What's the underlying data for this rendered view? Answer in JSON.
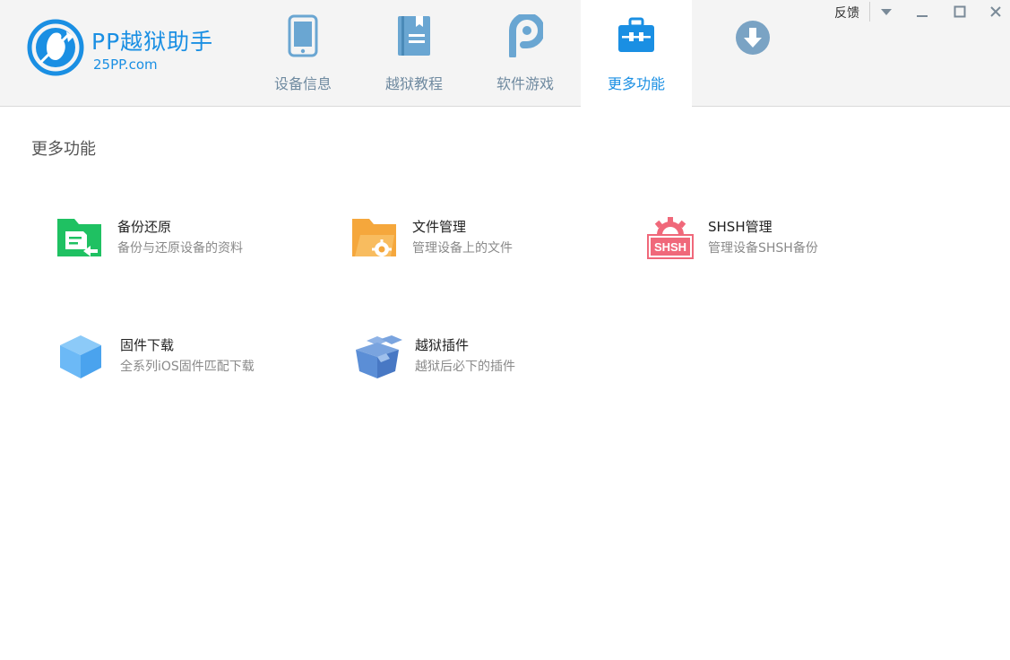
{
  "header": {
    "logo_title": "PP越狱助手",
    "logo_subtitle": "25PP.com",
    "tabs": [
      {
        "label": "设备信息",
        "icon": "phone-icon"
      },
      {
        "label": "越狱教程",
        "icon": "book-icon"
      },
      {
        "label": "软件游戏",
        "icon": "pp-icon"
      },
      {
        "label": "更多功能",
        "icon": "toolbox-icon",
        "active": true
      },
      {
        "label": "",
        "icon": "download-icon"
      }
    ],
    "window_controls": {
      "feedback": "反馈",
      "menu": "chevron-down-icon",
      "minimize": "minimize-icon",
      "maximize": "maximize-icon",
      "close": "close-icon"
    }
  },
  "main": {
    "section_title": "更多功能",
    "features": [
      {
        "name": "备份还原",
        "desc": "备份与还原设备的资料",
        "icon": "folder-restore-icon",
        "color": "#1fc162"
      },
      {
        "name": "文件管理",
        "desc": "管理设备上的文件",
        "icon": "folder-gear-icon",
        "color": "#f5a73c"
      },
      {
        "name": "SHSH管理",
        "desc": "管理设备SHSH备份",
        "icon": "shsh-icon",
        "color": "#f0687a",
        "icon_text": "SHSH"
      },
      {
        "name": "固件下载",
        "desc": "全系列iOS固件匹配下载",
        "icon": "cube-icon",
        "color": "#5fb3f5"
      },
      {
        "name": "越狱插件",
        "desc": "越狱后必下的插件",
        "icon": "boxes-icon",
        "color": "#5b8ed6"
      }
    ]
  },
  "colors": {
    "accent": "#1a8fe3",
    "tab_inactive": "#6f8aa0",
    "header_bg": "#f4f4f4"
  }
}
